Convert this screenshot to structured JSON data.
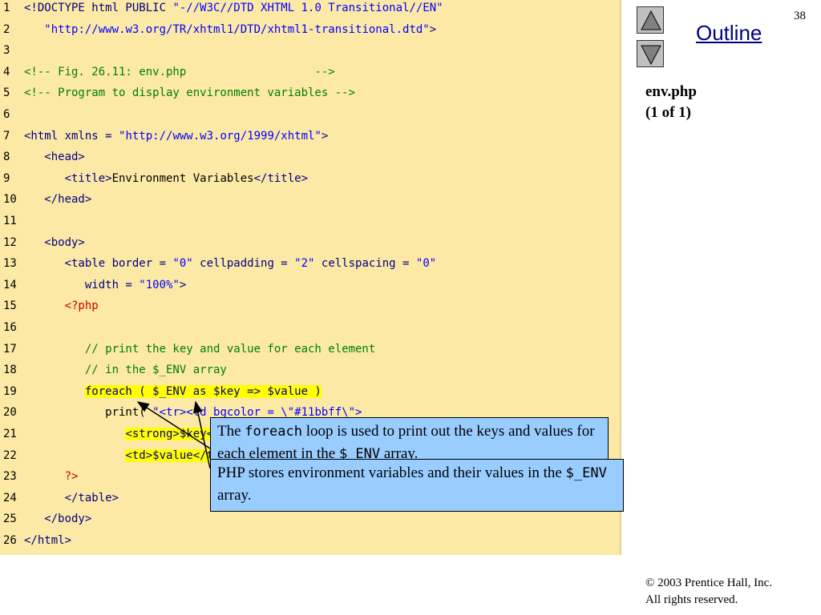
{
  "slide": {
    "page_number": "38",
    "outline_label": "Outline",
    "file_title": "env.php",
    "file_part": "(1 of 1)",
    "copyright_line1": "© 2003 Prentice Hall, Inc.",
    "copyright_line2": "All rights reserved."
  },
  "navigation": {
    "up_icon": "triangle-up-icon",
    "down_icon": "triangle-down-icon"
  },
  "colors": {
    "code_background": "#fde9a6",
    "callout_background": "#99ccff",
    "highlight": "#ffff00",
    "markup": "#000080",
    "string": "#0000ff",
    "comment": "#008000",
    "php_tag": "#cc0000"
  },
  "code": {
    "lines": [
      {
        "num": "1",
        "tokens": [
          {
            "t": "<!DOCTYPE html PUBLIC ",
            "c": "p"
          },
          {
            "t": "\"-//W3C//DTD XHTML 1.0 Transitional//EN\"",
            "c": "s"
          }
        ]
      },
      {
        "num": "2",
        "tokens": [
          {
            "t": "   ",
            "c": "p"
          },
          {
            "t": "\"http://www.w3.org/TR/xhtml1/DTD/xhtml1-transitional.dtd\"",
            "c": "s"
          },
          {
            "t": ">",
            "c": "p"
          }
        ]
      },
      {
        "num": "3",
        "tokens": []
      },
      {
        "num": "4",
        "tokens": [
          {
            "t": "<!-- Fig. 26.11: env.php                   -->",
            "c": "c"
          }
        ]
      },
      {
        "num": "5",
        "tokens": [
          {
            "t": "<!-- Program to display environment variables -->",
            "c": "c"
          }
        ]
      },
      {
        "num": "6",
        "tokens": []
      },
      {
        "num": "7",
        "tokens": [
          {
            "t": "<html xmlns = ",
            "c": "p"
          },
          {
            "t": "\"http://www.w3.org/1999/xhtml\"",
            "c": "s"
          },
          {
            "t": ">",
            "c": "p"
          }
        ]
      },
      {
        "num": "8",
        "tokens": [
          {
            "t": "   <head>",
            "c": "p"
          }
        ]
      },
      {
        "num": "9",
        "tokens": [
          {
            "t": "      <title>",
            "c": "p"
          },
          {
            "t": "Environment Variables",
            "c": "t"
          },
          {
            "t": "</title>",
            "c": "p"
          }
        ]
      },
      {
        "num": "10",
        "tokens": [
          {
            "t": "   </head>",
            "c": "p"
          }
        ]
      },
      {
        "num": "11",
        "tokens": []
      },
      {
        "num": "12",
        "tokens": [
          {
            "t": "   <body>",
            "c": "p"
          }
        ]
      },
      {
        "num": "13",
        "tokens": [
          {
            "t": "      <table border = ",
            "c": "p"
          },
          {
            "t": "\"0\"",
            "c": "s"
          },
          {
            "t": " cellpadding = ",
            "c": "p"
          },
          {
            "t": "\"2\"",
            "c": "s"
          },
          {
            "t": " cellspacing = ",
            "c": "p"
          },
          {
            "t": "\"0\"",
            "c": "s"
          }
        ]
      },
      {
        "num": "14",
        "tokens": [
          {
            "t": "         width = ",
            "c": "p"
          },
          {
            "t": "\"100%\"",
            "c": "s"
          },
          {
            "t": ">",
            "c": "p"
          }
        ]
      },
      {
        "num": "15",
        "tokens": [
          {
            "t": "      ",
            "c": "p"
          },
          {
            "t": "<?php",
            "c": "r"
          }
        ]
      },
      {
        "num": "16",
        "tokens": []
      },
      {
        "num": "17",
        "tokens": [
          {
            "t": "         // print the key and value for each element",
            "c": "c"
          }
        ]
      },
      {
        "num": "18",
        "tokens": [
          {
            "t": "         // in the $_ENV array",
            "c": "c"
          }
        ]
      },
      {
        "num": "19",
        "tokens": [
          {
            "t": "         ",
            "c": "p"
          },
          {
            "t": "foreach ( $_ENV as $key => $value )",
            "c": "p",
            "h": true
          }
        ]
      },
      {
        "num": "20",
        "tokens": [
          {
            "t": "            print( ",
            "c": "k"
          },
          {
            "t": "\"<tr><td bgcolor = \\\"#11bbff\\\">",
            "c": "s"
          }
        ]
      },
      {
        "num": "21",
        "tokens": [
          {
            "t": "               ",
            "c": "p"
          },
          {
            "t": "<strong>$key</strong></td>",
            "c": "p",
            "h": true
          }
        ]
      },
      {
        "num": "22",
        "tokens": [
          {
            "t": "               ",
            "c": "p"
          },
          {
            "t": "<td>$value</td></tr>\" );",
            "c": "p",
            "h": true
          }
        ]
      },
      {
        "num": "23",
        "tokens": [
          {
            "t": "      ",
            "c": "p"
          },
          {
            "t": "?>",
            "c": "r"
          }
        ]
      },
      {
        "num": "24",
        "tokens": [
          {
            "t": "      </table>",
            "c": "p"
          }
        ]
      },
      {
        "num": "25",
        "tokens": [
          {
            "t": "   </body>",
            "c": "p"
          }
        ]
      },
      {
        "num": "26",
        "tokens": [
          {
            "t": "</html>",
            "c": "p"
          }
        ]
      }
    ]
  },
  "callouts": {
    "foreach": {
      "pre": "The ",
      "code": "foreach",
      "post": " loop is used to print out the keys and values for each element in the ",
      "code2": "$_ENV",
      "post2": " array."
    },
    "env": {
      "pre": "PHP stores environment variables and their values in the ",
      "code": "$_ENV",
      "post": " array."
    }
  }
}
